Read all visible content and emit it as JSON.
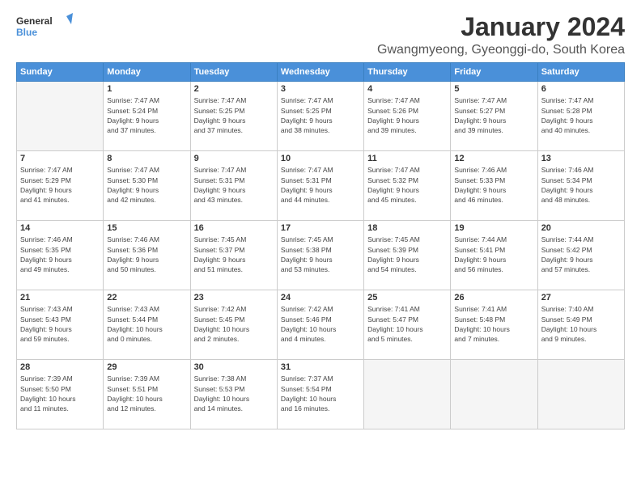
{
  "logo": {
    "line1": "General",
    "line2": "Blue"
  },
  "title": "January 2024",
  "location": "Gwangmyeong, Gyeonggi-do, South Korea",
  "weekdays": [
    "Sunday",
    "Monday",
    "Tuesday",
    "Wednesday",
    "Thursday",
    "Friday",
    "Saturday"
  ],
  "weeks": [
    [
      {
        "day": "",
        "info": ""
      },
      {
        "day": "1",
        "info": "Sunrise: 7:47 AM\nSunset: 5:24 PM\nDaylight: 9 hours\nand 37 minutes."
      },
      {
        "day": "2",
        "info": "Sunrise: 7:47 AM\nSunset: 5:25 PM\nDaylight: 9 hours\nand 37 minutes."
      },
      {
        "day": "3",
        "info": "Sunrise: 7:47 AM\nSunset: 5:25 PM\nDaylight: 9 hours\nand 38 minutes."
      },
      {
        "day": "4",
        "info": "Sunrise: 7:47 AM\nSunset: 5:26 PM\nDaylight: 9 hours\nand 39 minutes."
      },
      {
        "day": "5",
        "info": "Sunrise: 7:47 AM\nSunset: 5:27 PM\nDaylight: 9 hours\nand 39 minutes."
      },
      {
        "day": "6",
        "info": "Sunrise: 7:47 AM\nSunset: 5:28 PM\nDaylight: 9 hours\nand 40 minutes."
      }
    ],
    [
      {
        "day": "7",
        "info": "Sunrise: 7:47 AM\nSunset: 5:29 PM\nDaylight: 9 hours\nand 41 minutes."
      },
      {
        "day": "8",
        "info": "Sunrise: 7:47 AM\nSunset: 5:30 PM\nDaylight: 9 hours\nand 42 minutes."
      },
      {
        "day": "9",
        "info": "Sunrise: 7:47 AM\nSunset: 5:31 PM\nDaylight: 9 hours\nand 43 minutes."
      },
      {
        "day": "10",
        "info": "Sunrise: 7:47 AM\nSunset: 5:31 PM\nDaylight: 9 hours\nand 44 minutes."
      },
      {
        "day": "11",
        "info": "Sunrise: 7:47 AM\nSunset: 5:32 PM\nDaylight: 9 hours\nand 45 minutes."
      },
      {
        "day": "12",
        "info": "Sunrise: 7:46 AM\nSunset: 5:33 PM\nDaylight: 9 hours\nand 46 minutes."
      },
      {
        "day": "13",
        "info": "Sunrise: 7:46 AM\nSunset: 5:34 PM\nDaylight: 9 hours\nand 48 minutes."
      }
    ],
    [
      {
        "day": "14",
        "info": "Sunrise: 7:46 AM\nSunset: 5:35 PM\nDaylight: 9 hours\nand 49 minutes."
      },
      {
        "day": "15",
        "info": "Sunrise: 7:46 AM\nSunset: 5:36 PM\nDaylight: 9 hours\nand 50 minutes."
      },
      {
        "day": "16",
        "info": "Sunrise: 7:45 AM\nSunset: 5:37 PM\nDaylight: 9 hours\nand 51 minutes."
      },
      {
        "day": "17",
        "info": "Sunrise: 7:45 AM\nSunset: 5:38 PM\nDaylight: 9 hours\nand 53 minutes."
      },
      {
        "day": "18",
        "info": "Sunrise: 7:45 AM\nSunset: 5:39 PM\nDaylight: 9 hours\nand 54 minutes."
      },
      {
        "day": "19",
        "info": "Sunrise: 7:44 AM\nSunset: 5:41 PM\nDaylight: 9 hours\nand 56 minutes."
      },
      {
        "day": "20",
        "info": "Sunrise: 7:44 AM\nSunset: 5:42 PM\nDaylight: 9 hours\nand 57 minutes."
      }
    ],
    [
      {
        "day": "21",
        "info": "Sunrise: 7:43 AM\nSunset: 5:43 PM\nDaylight: 9 hours\nand 59 minutes."
      },
      {
        "day": "22",
        "info": "Sunrise: 7:43 AM\nSunset: 5:44 PM\nDaylight: 10 hours\nand 0 minutes."
      },
      {
        "day": "23",
        "info": "Sunrise: 7:42 AM\nSunset: 5:45 PM\nDaylight: 10 hours\nand 2 minutes."
      },
      {
        "day": "24",
        "info": "Sunrise: 7:42 AM\nSunset: 5:46 PM\nDaylight: 10 hours\nand 4 minutes."
      },
      {
        "day": "25",
        "info": "Sunrise: 7:41 AM\nSunset: 5:47 PM\nDaylight: 10 hours\nand 5 minutes."
      },
      {
        "day": "26",
        "info": "Sunrise: 7:41 AM\nSunset: 5:48 PM\nDaylight: 10 hours\nand 7 minutes."
      },
      {
        "day": "27",
        "info": "Sunrise: 7:40 AM\nSunset: 5:49 PM\nDaylight: 10 hours\nand 9 minutes."
      }
    ],
    [
      {
        "day": "28",
        "info": "Sunrise: 7:39 AM\nSunset: 5:50 PM\nDaylight: 10 hours\nand 11 minutes."
      },
      {
        "day": "29",
        "info": "Sunrise: 7:39 AM\nSunset: 5:51 PM\nDaylight: 10 hours\nand 12 minutes."
      },
      {
        "day": "30",
        "info": "Sunrise: 7:38 AM\nSunset: 5:53 PM\nDaylight: 10 hours\nand 14 minutes."
      },
      {
        "day": "31",
        "info": "Sunrise: 7:37 AM\nSunset: 5:54 PM\nDaylight: 10 hours\nand 16 minutes."
      },
      {
        "day": "",
        "info": ""
      },
      {
        "day": "",
        "info": ""
      },
      {
        "day": "",
        "info": ""
      }
    ]
  ]
}
